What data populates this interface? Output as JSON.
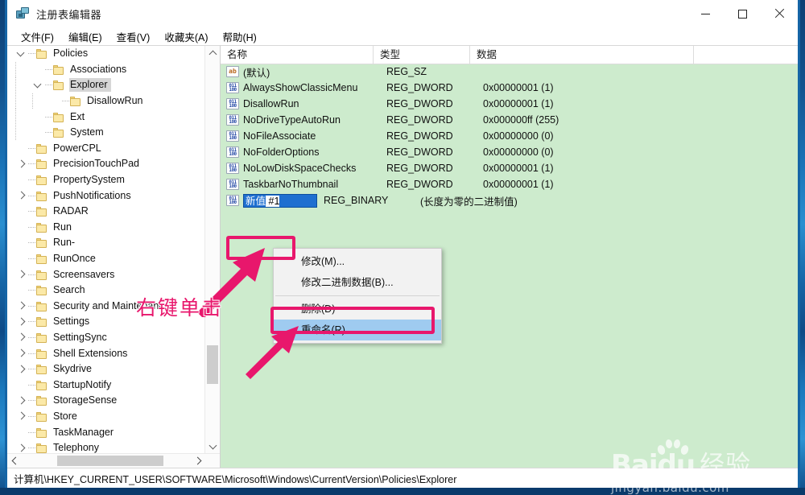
{
  "window": {
    "title": "注册表编辑器",
    "icon": "registry-editor-icon",
    "controls": {
      "minimize": "最小化",
      "maximize": "最大化",
      "close": "关闭"
    }
  },
  "menubar": [
    {
      "label": "文件(F)",
      "name": "menu-file"
    },
    {
      "label": "编辑(E)",
      "name": "menu-edit"
    },
    {
      "label": "查看(V)",
      "name": "menu-view"
    },
    {
      "label": "收藏夹(A)",
      "name": "menu-favorites"
    },
    {
      "label": "帮助(H)",
      "name": "menu-help"
    }
  ],
  "tree": {
    "items": [
      {
        "label": "Policies",
        "depth": 1,
        "twisty": "expanded",
        "selected": false
      },
      {
        "label": "Associations",
        "depth": 2,
        "twisty": "none",
        "selected": false
      },
      {
        "label": "Explorer",
        "depth": 2,
        "twisty": "expanded",
        "selected": true
      },
      {
        "label": "DisallowRun",
        "depth": 3,
        "twisty": "none",
        "selected": false
      },
      {
        "label": "Ext",
        "depth": 2,
        "twisty": "none",
        "selected": false
      },
      {
        "label": "System",
        "depth": 2,
        "twisty": "none",
        "selected": false
      },
      {
        "label": "PowerCPL",
        "depth": 1,
        "twisty": "none",
        "selected": false
      },
      {
        "label": "PrecisionTouchPad",
        "depth": 1,
        "twisty": "collapsed",
        "selected": false
      },
      {
        "label": "PropertySystem",
        "depth": 1,
        "twisty": "none",
        "selected": false
      },
      {
        "label": "PushNotifications",
        "depth": 1,
        "twisty": "collapsed",
        "selected": false
      },
      {
        "label": "RADAR",
        "depth": 1,
        "twisty": "none",
        "selected": false
      },
      {
        "label": "Run",
        "depth": 1,
        "twisty": "none",
        "selected": false
      },
      {
        "label": "Run-",
        "depth": 1,
        "twisty": "none",
        "selected": false
      },
      {
        "label": "RunOnce",
        "depth": 1,
        "twisty": "none",
        "selected": false
      },
      {
        "label": "Screensavers",
        "depth": 1,
        "twisty": "collapsed",
        "selected": false
      },
      {
        "label": "Search",
        "depth": 1,
        "twisty": "none",
        "selected": false
      },
      {
        "label": "Security and Maintenance",
        "depth": 1,
        "twisty": "collapsed",
        "selected": false
      },
      {
        "label": "Settings",
        "depth": 1,
        "twisty": "collapsed",
        "selected": false
      },
      {
        "label": "SettingSync",
        "depth": 1,
        "twisty": "collapsed",
        "selected": false
      },
      {
        "label": "Shell Extensions",
        "depth": 1,
        "twisty": "collapsed",
        "selected": false
      },
      {
        "label": "Skydrive",
        "depth": 1,
        "twisty": "collapsed",
        "selected": false
      },
      {
        "label": "StartupNotify",
        "depth": 1,
        "twisty": "none",
        "selected": false
      },
      {
        "label": "StorageSense",
        "depth": 1,
        "twisty": "collapsed",
        "selected": false
      },
      {
        "label": "Store",
        "depth": 1,
        "twisty": "collapsed",
        "selected": false
      },
      {
        "label": "TaskManager",
        "depth": 1,
        "twisty": "none",
        "selected": false
      },
      {
        "label": "Telephony",
        "depth": 1,
        "twisty": "collapsed",
        "selected": false
      }
    ]
  },
  "list": {
    "columns": [
      {
        "label": "名称",
        "name": "column-name"
      },
      {
        "label": "类型",
        "name": "column-type"
      },
      {
        "label": "数据",
        "name": "column-data"
      }
    ],
    "rows": [
      {
        "name": "(默认)",
        "type": "REG_SZ",
        "data": "",
        "icon": "string-value-icon",
        "editing": false
      },
      {
        "name": "AlwaysShowClassicMenu",
        "type": "REG_DWORD",
        "data": "0x00000001 (1)",
        "icon": "dword-value-icon",
        "editing": false
      },
      {
        "name": "DisallowRun",
        "type": "REG_DWORD",
        "data": "0x00000001 (1)",
        "icon": "dword-value-icon",
        "editing": false
      },
      {
        "name": "NoDriveTypeAutoRun",
        "type": "REG_DWORD",
        "data": "0x000000ff (255)",
        "icon": "dword-value-icon",
        "editing": false
      },
      {
        "name": "NoFileAssociate",
        "type": "REG_DWORD",
        "data": "0x00000000 (0)",
        "icon": "dword-value-icon",
        "editing": false
      },
      {
        "name": "NoFolderOptions",
        "type": "REG_DWORD",
        "data": "0x00000000 (0)",
        "icon": "dword-value-icon",
        "editing": false
      },
      {
        "name": "NoLowDiskSpaceChecks",
        "type": "REG_DWORD",
        "data": "0x00000001 (1)",
        "icon": "dword-value-icon",
        "editing": false
      },
      {
        "name": "TaskbarNoThumbnail",
        "type": "REG_DWORD",
        "data": "0x00000001 (1)",
        "icon": "dword-value-icon",
        "editing": false
      },
      {
        "name": "新值 #1",
        "type": "REG_BINARY",
        "data": "(长度为零的二进制值)",
        "icon": "binary-value-icon",
        "editing": true,
        "edit_selected_text": "新值",
        "edit_rest_text": " #1"
      }
    ]
  },
  "context_menu": {
    "items": [
      {
        "label": "修改(M)...",
        "highlighted": false,
        "name": "context-menu-modify"
      },
      {
        "label": "修改二进制数据(B)...",
        "highlighted": false,
        "name": "context-menu-modify-binary"
      },
      {
        "separator": true
      },
      {
        "label": "删除(D)",
        "highlighted": false,
        "name": "context-menu-delete"
      },
      {
        "label": "重命名(R)",
        "highlighted": true,
        "name": "context-menu-rename"
      }
    ]
  },
  "statusbar": {
    "path": "计算机\\HKEY_CURRENT_USER\\SOFTWARE\\Microsoft\\Windows\\CurrentVersion\\Policies\\Explorer"
  },
  "annotations": {
    "right_click_text": "右键单击",
    "highlight_color": "#e8176c",
    "boxes": [
      {
        "name": "new-value-highlight",
        "target": "新值 #1"
      },
      {
        "name": "rename-highlight",
        "target": "重命名(R)"
      }
    ]
  },
  "watermark": {
    "brand": "Baidu",
    "product": "经验",
    "url": "jingyan.baidu.com"
  },
  "colors": {
    "list_background": "#cdebcd",
    "selection_blue": "#1e6fd0",
    "menu_highlight": "#9fcbf0",
    "annotation_pink": "#e8176c",
    "desktop_blue": "#1565a6"
  }
}
